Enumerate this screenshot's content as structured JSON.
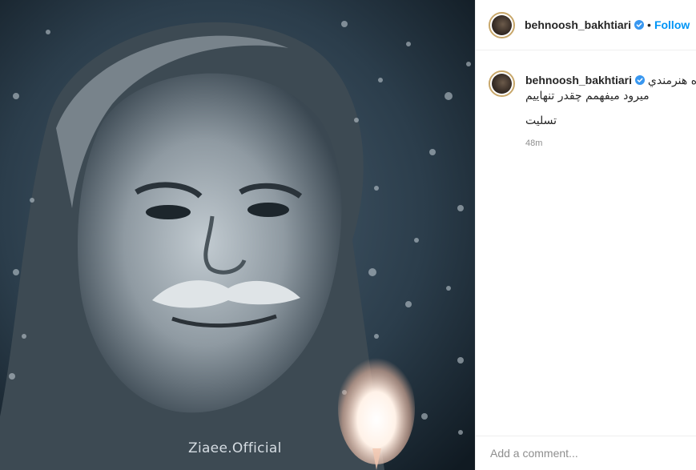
{
  "post": {
    "image_watermark": "Ziaee.Official"
  },
  "header": {
    "username": "behnoosh_bakhtiari",
    "separator": "•",
    "follow_label": "Follow"
  },
  "caption": {
    "username": "behnoosh_bakhtiari",
    "line1": "اه هنرمندي",
    "line2": "میرود میفهمم چقدر تنهاییم",
    "line3": "تسلیت",
    "timestamp": "48m"
  },
  "comment_box": {
    "placeholder": "Add a comment..."
  },
  "colors": {
    "link": "#0095f6",
    "verified": "#3897f0",
    "muted": "#8e8e8e"
  }
}
